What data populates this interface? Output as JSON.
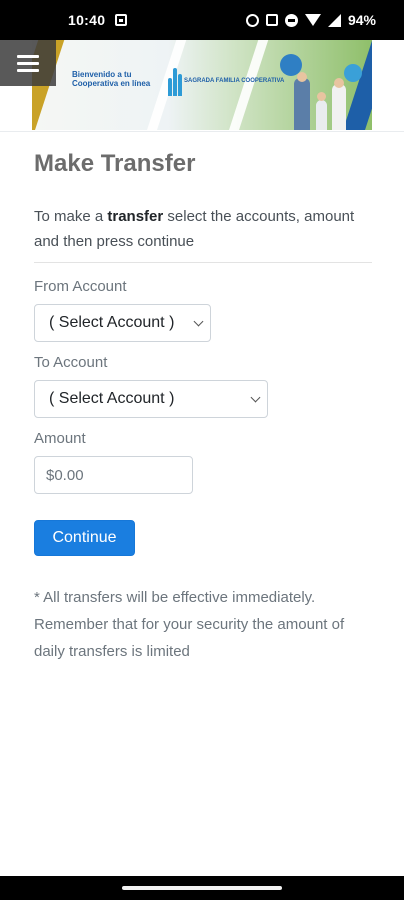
{
  "status_bar": {
    "time": "10:40",
    "battery": "94%",
    "icons": [
      "image-icon",
      "alarm-icon",
      "calendar-icon",
      "do-not-disturb-icon",
      "wifi-icon",
      "signal-icon"
    ]
  },
  "header": {
    "menu_icon": "hamburger-menu-icon",
    "banner_welcome": "Bienvenido a tu Cooperativa en línea",
    "banner_brand": "SAGRADA FAMILIA COOPERATIVA"
  },
  "page": {
    "title": "Make Transfer",
    "intro_before": "To make a ",
    "intro_bold": "transfer",
    "intro_after": " select the accounts, amount and then press continue"
  },
  "form": {
    "from_label": "From Account",
    "from_value": "( Select Account )",
    "to_label": "To Account",
    "to_value": "( Select Account )",
    "amount_label": "Amount",
    "amount_placeholder": "$0.00",
    "continue_label": "Continue"
  },
  "note": "* All transfers will be effective immediately. Remember that for your security the amount of daily transfers is limited",
  "colors": {
    "primary": "#1a7ee0",
    "title": "#6c6c6c",
    "banner_gold": "#c9a227",
    "banner_blue": "#1e5fa8"
  }
}
